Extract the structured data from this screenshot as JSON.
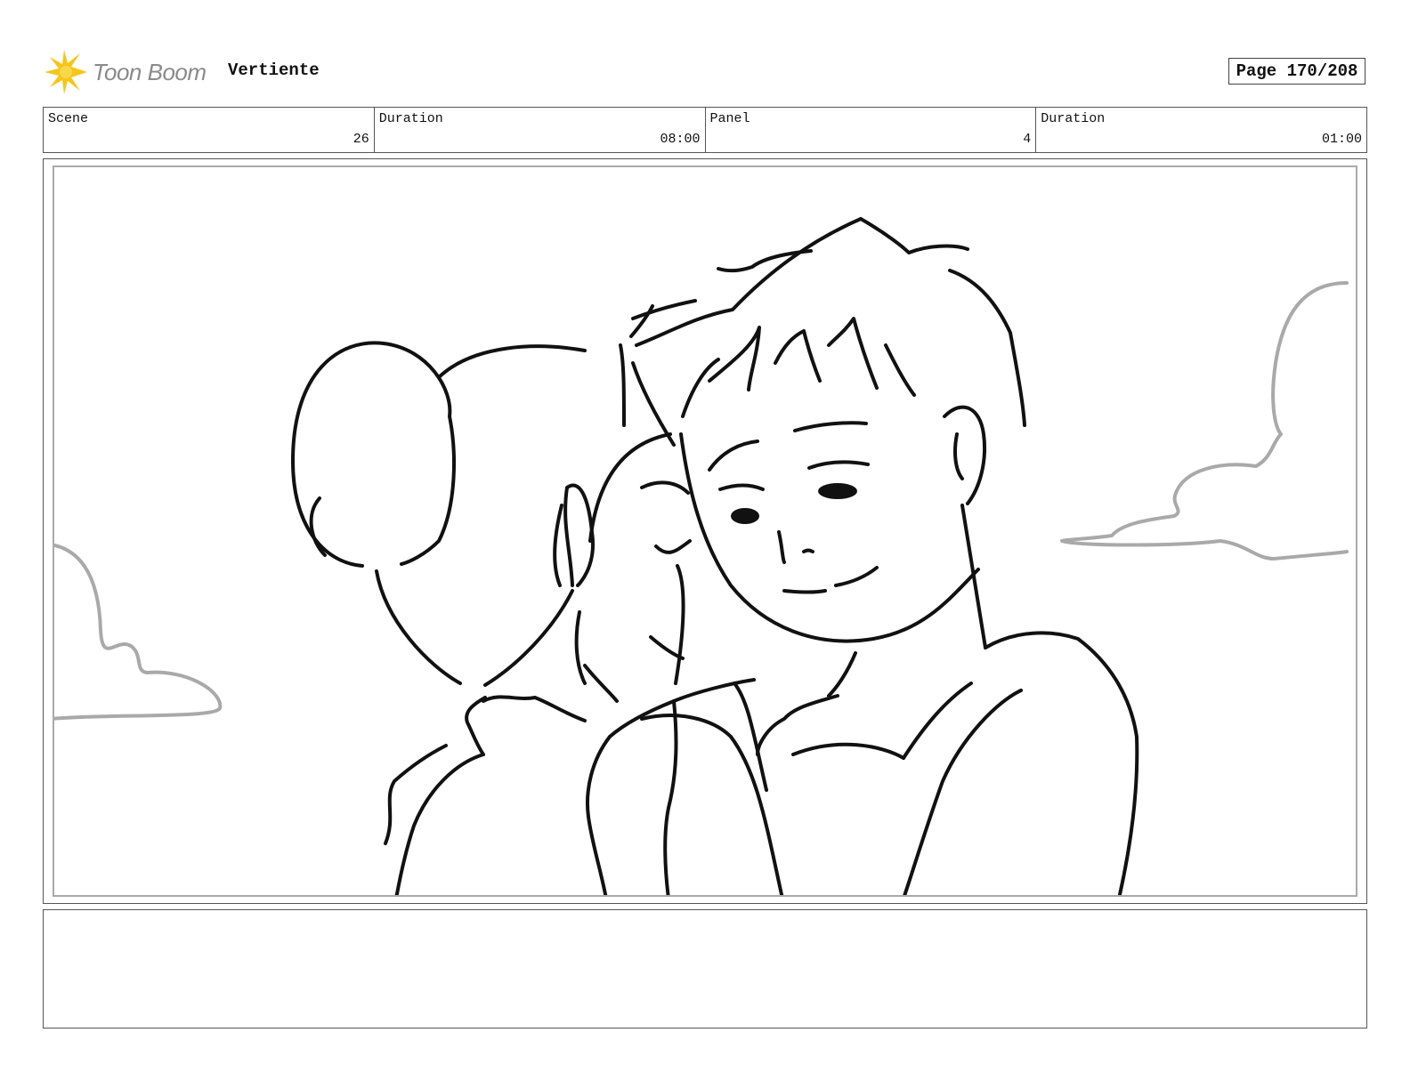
{
  "header": {
    "logo_text": "Toon Boom",
    "project_title": "Vertiente",
    "page_label": "Page 170/208"
  },
  "info": {
    "scene_label": "Scene",
    "scene_value": "26",
    "scene_duration_label": "Duration",
    "scene_duration_value": "08:00",
    "panel_label": "Panel",
    "panel_value": "4",
    "panel_duration_label": "Duration",
    "panel_duration_value": "01:00"
  },
  "panel_image": {
    "icon": "storyboard-sketch-two-characters-clouds"
  },
  "notes": {
    "text": ""
  }
}
